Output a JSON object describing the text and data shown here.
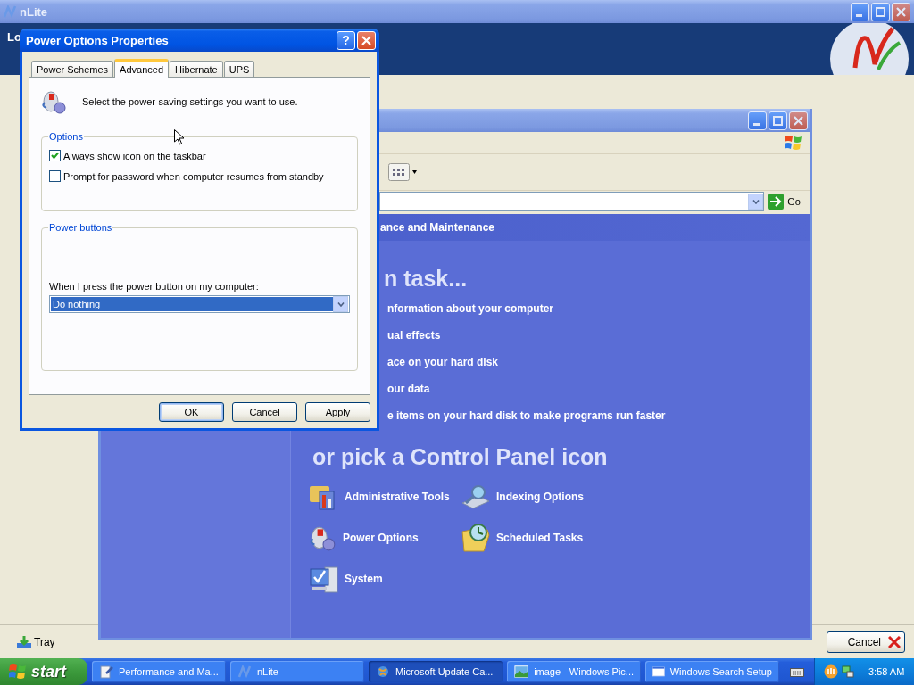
{
  "nlite": {
    "title": "nLite",
    "header_text": "Lo",
    "tray_label": "Tray",
    "cancel_label": "Cancel"
  },
  "control_panel": {
    "go_label": "Go",
    "category": "ance and Maintenance",
    "task_heading": "n task...",
    "tasks": [
      "nformation about your computer",
      "ual effects",
      "ace on your hard disk",
      "our data",
      "e items on your hard disk to make programs run faster"
    ],
    "icon_heading": "or pick a Control Panel icon",
    "icons": [
      {
        "label": "Administrative Tools",
        "kind": "admin"
      },
      {
        "label": "Indexing Options",
        "kind": "indexing"
      },
      {
        "label": "Power Options",
        "kind": "power"
      },
      {
        "label": "Scheduled Tasks",
        "kind": "scheduled"
      },
      {
        "label": "System",
        "kind": "system"
      }
    ]
  },
  "dialog": {
    "title": "Power Options Properties",
    "help_label": "?",
    "tabs": [
      {
        "label": "Power Schemes",
        "selected": false
      },
      {
        "label": "Advanced",
        "selected": true
      },
      {
        "label": "Hibernate",
        "selected": false
      },
      {
        "label": "UPS",
        "selected": false
      }
    ],
    "intro": "Select the power-saving settings you want to use.",
    "options_legend": "Options",
    "options": [
      {
        "label": "Always show icon on the taskbar",
        "checked": true
      },
      {
        "label": "Prompt for password when computer resumes from standby",
        "checked": false
      }
    ],
    "buttons_legend": "Power buttons",
    "power_label": "When I press the power button on my computer:",
    "power_value": "Do nothing",
    "buttons": [
      {
        "label": "OK",
        "default": true
      },
      {
        "label": "Cancel",
        "default": false
      },
      {
        "label": "Apply",
        "default": false
      }
    ]
  },
  "taskbar": {
    "start_label": "start",
    "tasks": [
      {
        "label": "Performance and Ma...",
        "kind": "panel",
        "selected": false
      },
      {
        "label": "nLite",
        "kind": "nlite",
        "selected": false
      },
      {
        "label": "Microsoft Update Ca...",
        "kind": "update",
        "selected": true
      },
      {
        "label": "image - Windows Pic...",
        "kind": "image",
        "selected": false
      },
      {
        "label": "Windows Search Setup",
        "kind": "window",
        "selected": false
      }
    ],
    "clock": "3:58 AM"
  }
}
